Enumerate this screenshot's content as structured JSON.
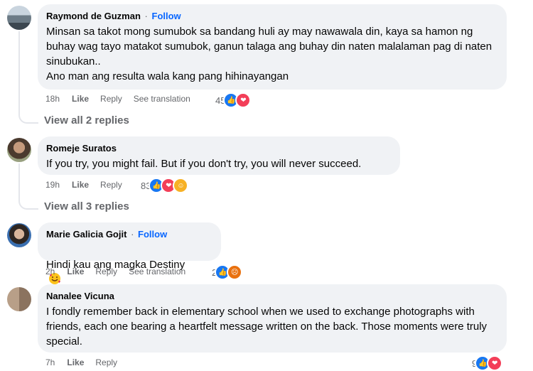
{
  "comments": [
    {
      "author": "Raymond de Guzman",
      "follow": "Follow",
      "separator": "·",
      "text": "Minsan sa takot mong sumubok sa bandang huli ay may nawawala din, kaya sa hamon ng buhay wag tayo matakot sumubok, ganun talaga ang buhay din naten malalaman pag di naten sinubukan..\nAno man ang resulta wala kang pang hihinayangan",
      "time": "18h",
      "like": "Like",
      "reply": "Reply",
      "translate": "See translation",
      "reaction_count": "45",
      "reactions": [
        "like-icon",
        "love-icon"
      ]
    },
    {
      "author": "Romeje Suratos",
      "text": "If you try, you might fail. But if you don't try, you will never succeed.",
      "time": "19h",
      "like": "Like",
      "reply": "Reply",
      "reaction_count": "83",
      "reactions": [
        "like-icon",
        "love-icon",
        "care-icon"
      ]
    },
    {
      "author": "Marie Galicia Gojit",
      "follow": "Follow",
      "separator": "·",
      "text": "Hindi kau ang magka Destiny",
      "time": "2h",
      "like": "Like",
      "reply": "Reply",
      "translate": "See translation",
      "reaction_count": "2",
      "reactions": [
        "like-icon",
        "angry-icon"
      ]
    },
    {
      "author": "Nanalee Vicuna",
      "text": "I fondly remember back in elementary school when we used to exchange photographs with friends, each one bearing a heartfelt message written on the back. Those moments were truly special.",
      "time": "7h",
      "like": "Like",
      "reply": "Reply",
      "reaction_count": "9",
      "reactions": [
        "like-icon",
        "love-icon"
      ]
    }
  ],
  "replies": [
    {
      "label": "View all 2 replies"
    },
    {
      "label": "View all 3 replies"
    }
  ],
  "colors": {
    "bubble": "#f0f2f5",
    "follow": "#0866ff",
    "meta": "#65676b",
    "like": "#1877f2",
    "love": "#f33e58"
  }
}
